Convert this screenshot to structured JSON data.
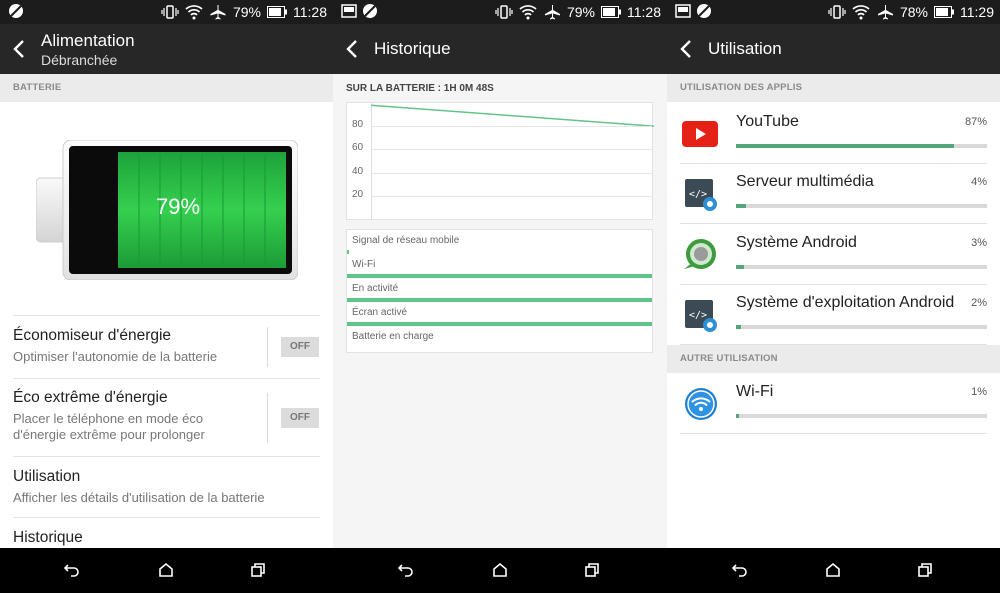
{
  "status": [
    {
      "battery": "79%",
      "time": "11:28"
    },
    {
      "battery": "79%",
      "time": "11:28"
    },
    {
      "battery": "78%",
      "time": "11:29"
    }
  ],
  "power": {
    "title": "Alimentation",
    "subtitle": "Débranchée",
    "section": "BATTERIE",
    "level": "79%",
    "level_fraction": 0.79,
    "items": [
      {
        "title": "Économiseur d'énergie",
        "subtitle": "Optimiser l'autonomie de la batterie",
        "toggle": "OFF"
      },
      {
        "title": "Éco extrême d'énergie",
        "subtitle": "Placer le téléphone en mode éco d'énergie extrême pour prolonger",
        "toggle": "OFF"
      },
      {
        "title": "Utilisation",
        "subtitle": "Afficher les détails d'utilisation de la batterie"
      },
      {
        "title": "Historique"
      }
    ]
  },
  "history": {
    "title": "Historique",
    "on_battery": "SUR LA BATTERIE : 1H 0M 48S",
    "chart_data": {
      "type": "line",
      "y_ticks": [
        "80",
        "60",
        "40",
        "20"
      ],
      "ylim": [
        0,
        100
      ],
      "x": [
        0,
        1
      ],
      "values": [
        98,
        80
      ],
      "color": "#63c487"
    },
    "signals": [
      {
        "label": "Signal de réseau mobile",
        "active": false
      },
      {
        "label": "Wi-Fi",
        "active": true
      },
      {
        "label": "En activité",
        "active": true
      },
      {
        "label": "Écran activé",
        "active": true
      },
      {
        "label": "Batterie en charge",
        "active": false
      }
    ]
  },
  "usage": {
    "title": "Utilisation",
    "apps_section": "UTILISATION DES APPLIS",
    "apps": [
      {
        "name": "YouTube",
        "percent": "87%",
        "fraction": 0.87,
        "icon": "youtube-icon"
      },
      {
        "name": "Serveur multimédia",
        "percent": "4%",
        "fraction": 0.04,
        "icon": "system-process-icon"
      },
      {
        "name": "Système Android",
        "percent": "3%",
        "fraction": 0.03,
        "icon": "android-system-icon"
      },
      {
        "name": "Système d'exploitation Android",
        "percent": "2%",
        "fraction": 0.02,
        "icon": "system-process-icon"
      }
    ],
    "other_section": "AUTRE UTILISATION",
    "other": [
      {
        "name": "Wi-Fi",
        "percent": "1%",
        "fraction": 0.01,
        "icon": "wifi-icon"
      }
    ]
  },
  "colors": {
    "accent": "#53a776",
    "battery_green": "#2ec84a",
    "bar_green": "#63c487"
  }
}
